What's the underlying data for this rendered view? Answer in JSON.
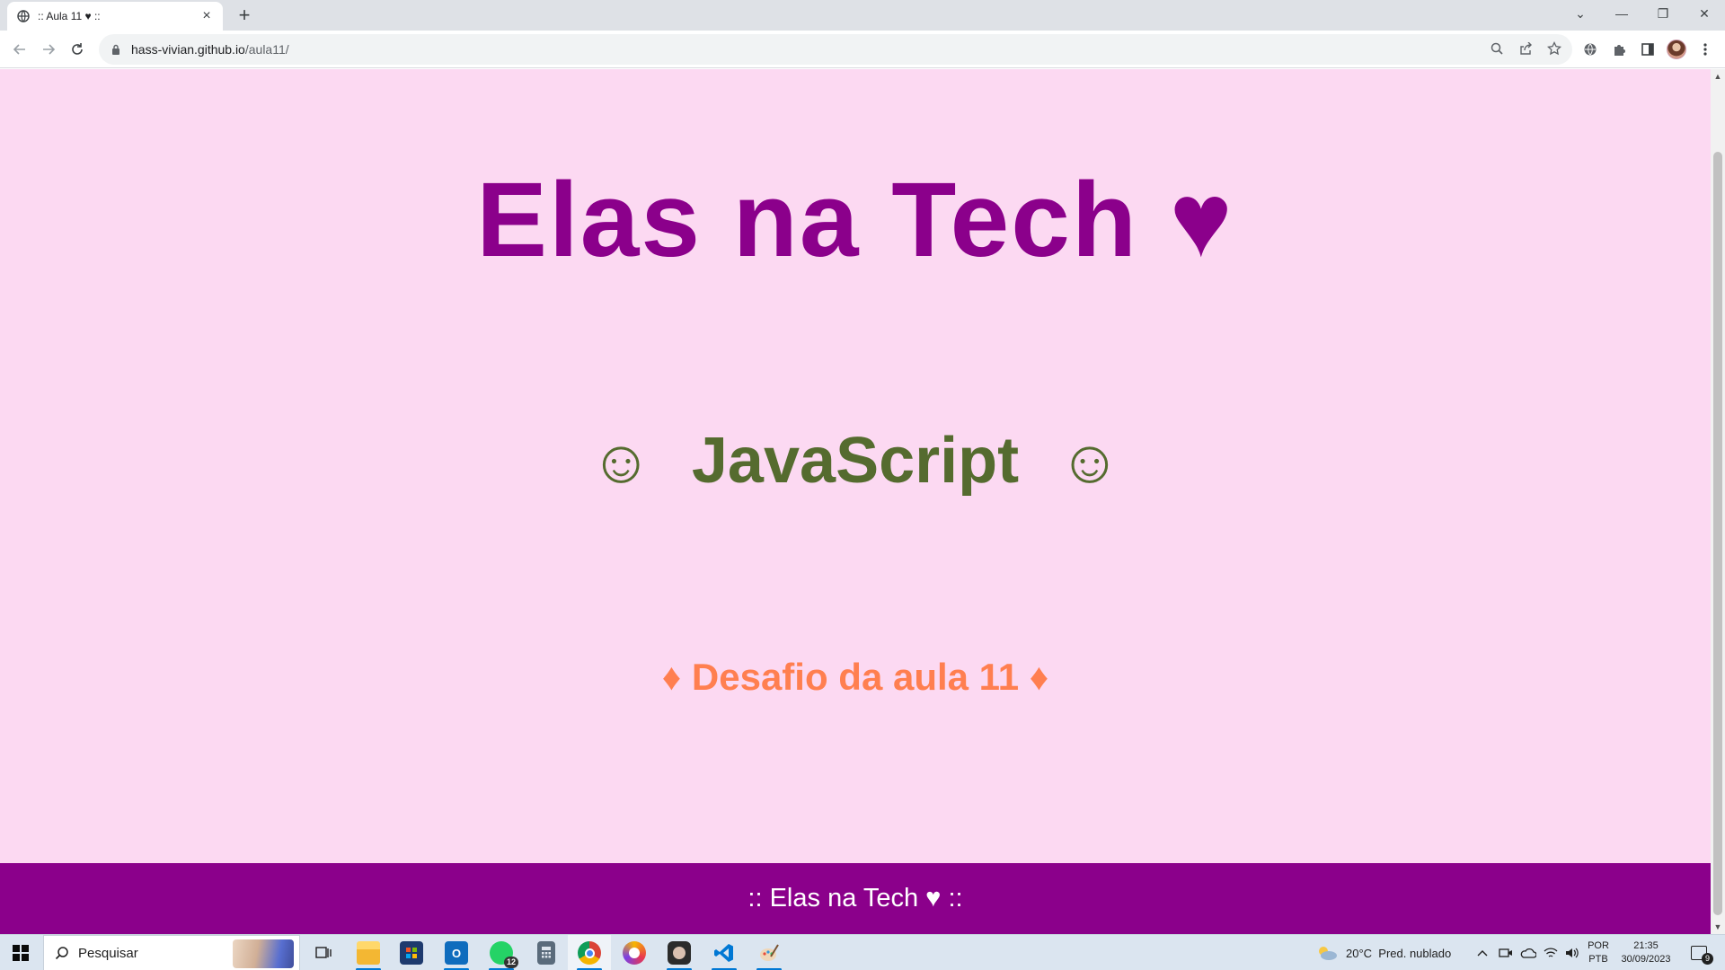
{
  "browser": {
    "tab_title": ":: Aula 11 ♥ ::",
    "tab_close": "×",
    "new_tab": "+",
    "url_host": "hass-vivian.github.io",
    "url_path": "/aula11/",
    "window_controls": {
      "dropdown": "⌄",
      "minimize": "—",
      "restore": "❐",
      "close": "✕"
    }
  },
  "page": {
    "heading1": "Elas na Tech ♥",
    "heading2": "JavaScript",
    "smile_left": "☺",
    "smile_right": "☺",
    "heading3": "♦ Desafio da aula 11 ♦",
    "footer": ":: Elas na Tech ♥ ::",
    "colors": {
      "background": "#fcd9f2",
      "heading1": "#8b008b",
      "heading2": "#556b2f",
      "heading3": "#ff7f50",
      "footer_bg": "#8b008b"
    }
  },
  "taskbar": {
    "search_placeholder": "Pesquisar",
    "whatsapp_badge": "12",
    "weather": "20°C  Pred. nublado",
    "lang_top": "POR",
    "lang_bottom": "PTB",
    "time": "21:35",
    "date": "30/09/2023",
    "notifications": "9"
  }
}
